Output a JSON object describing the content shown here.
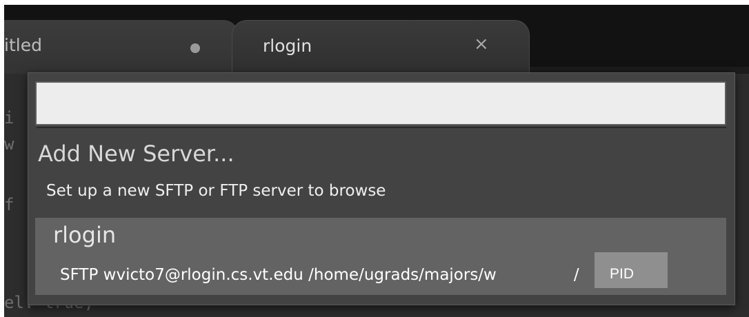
{
  "tabs": [
    {
      "label": "itled",
      "state": "modified"
    },
    {
      "label": "rlogin",
      "close_glyph": "×"
    }
  ],
  "editor": {
    "lines": [
      {
        "text": "i"
      },
      {
        "text": "w"
      },
      {
        "text": "f"
      },
      {
        "text": "el: true,"
      }
    ]
  },
  "palette": {
    "search": {
      "value": "",
      "placeholder": ""
    },
    "items": [
      {
        "title": "Add New Server...",
        "subtitle": "Set up a new SFTP or FTP server to browse"
      },
      {
        "title": "rlogin",
        "subtitle": "SFTP wvicto7@rlogin.cs.vt.edu /home/ugrads/majors/w",
        "subtitle_suffix": "/",
        "selected": true
      }
    ]
  },
  "redaction_label": "PID",
  "colors": {
    "panel_bg": "#434343",
    "selected_bg": "#636363",
    "tab_bar": "#121212"
  }
}
